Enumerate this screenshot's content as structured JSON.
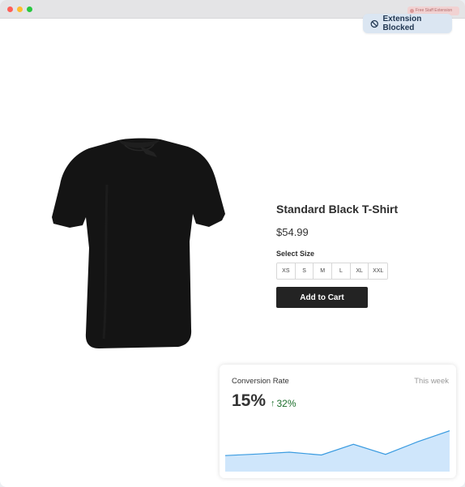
{
  "extension": {
    "pill_label": "Free Staff Extension",
    "blocked_label": "Extension Blocked"
  },
  "product": {
    "title": "Standard Black T-Shirt",
    "price": "$54.99",
    "size_label": "Select Size",
    "sizes": [
      "XS",
      "S",
      "M",
      "L",
      "XL",
      "XXL"
    ],
    "add_to_cart_label": "Add to Cart",
    "image_icon": "tshirt-image"
  },
  "conversion": {
    "title": "Conversion Rate",
    "period": "This week",
    "value": "15%",
    "change": "32%",
    "change_direction": "up",
    "change_color": "#1b6e2a"
  },
  "chart_data": {
    "type": "area",
    "title": "",
    "xlabel": "",
    "ylabel": "",
    "x": [
      0,
      1,
      2,
      3,
      4,
      5,
      6,
      7
    ],
    "values": [
      5.1,
      5.6,
      6.2,
      5.3,
      8.7,
      5.5,
      9.5,
      13.0
    ],
    "ylim": [
      0,
      16
    ],
    "grid": false,
    "fill_color": "#cfe6fb",
    "line_color": "#3a9be0"
  }
}
